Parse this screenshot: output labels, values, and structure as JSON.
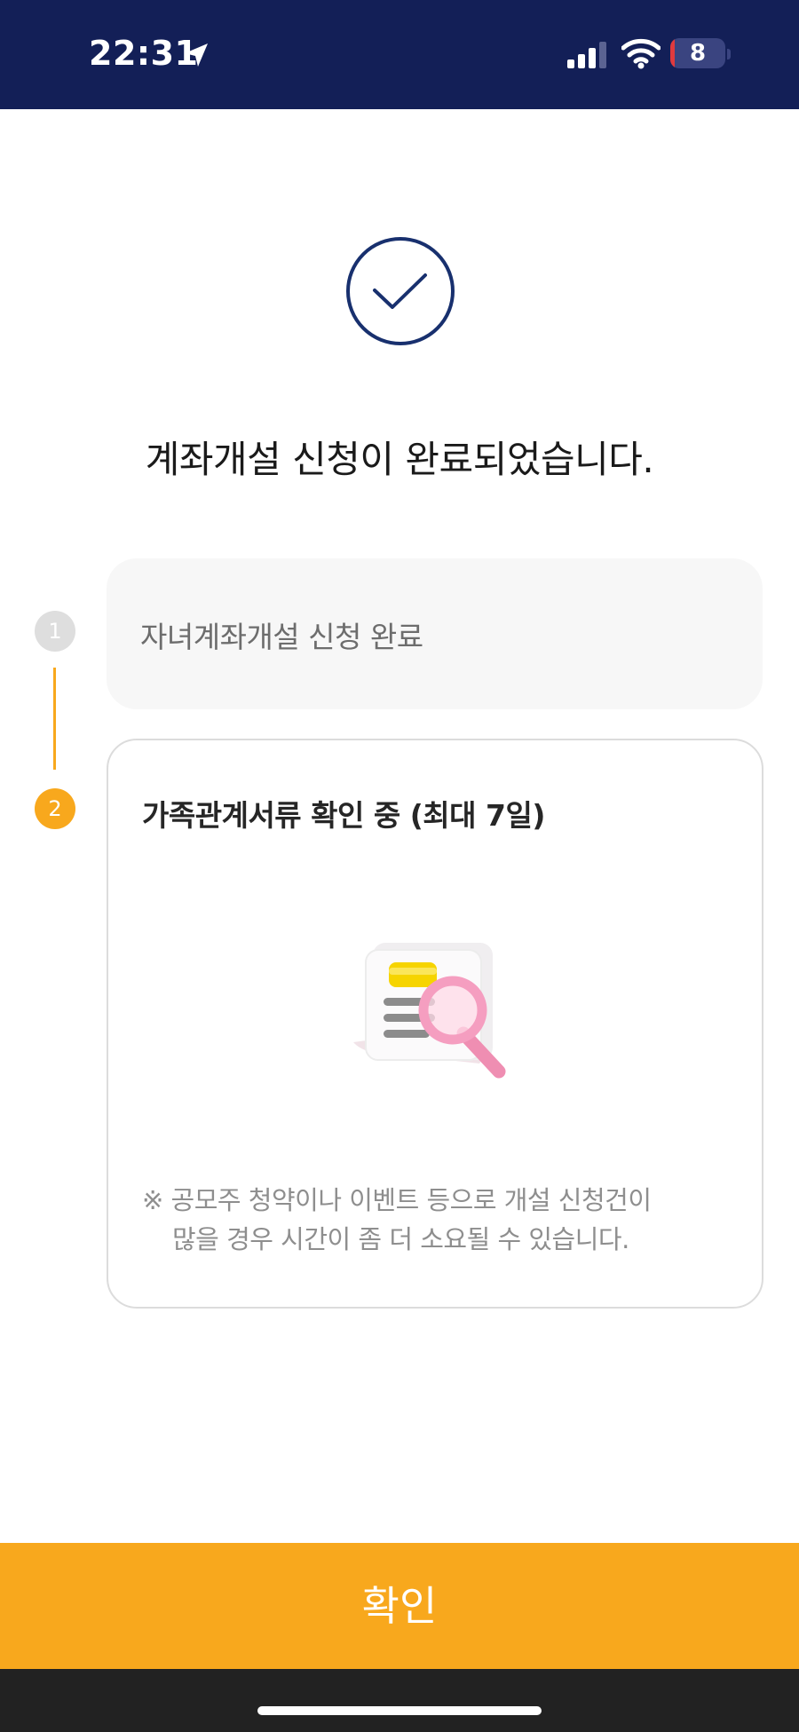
{
  "status_bar": {
    "time": "22:31",
    "battery_level": "8",
    "battery_fraction": 0.08,
    "background_color": "#131f57",
    "icons": [
      "location-arrow-icon",
      "cellular-signal-icon",
      "wifi-icon",
      "battery-icon"
    ]
  },
  "result": {
    "icon": "check-circle-icon",
    "title": "계좌개설 신청이 완료되었습니다."
  },
  "steps": [
    {
      "number": "1",
      "label": "자녀계좌개설 신청 완료",
      "state": "done"
    },
    {
      "number": "2",
      "label": "가족관계서류 확인 중 (최대 7일)",
      "state": "current"
    }
  ],
  "illustration": "document-search-illustration",
  "notice": {
    "line1": "※ 공모주 청약이나 이벤트 등으로 개설 신청건이",
    "line2": "많을 경우 시간이 좀 더 소요될 수 있습니다."
  },
  "confirm_button": {
    "label": "확인"
  },
  "colors": {
    "accent": "#f8a81d",
    "navy": "#131f57",
    "step_done": "#dedede"
  }
}
